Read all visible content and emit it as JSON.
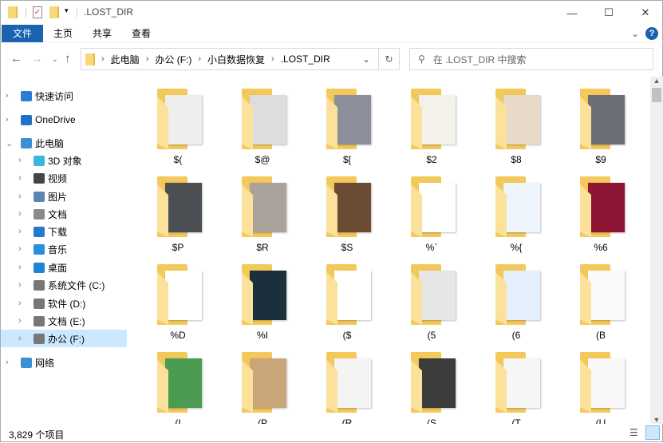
{
  "window": {
    "title": ".LOST_DIR",
    "minimize": "—",
    "maximize": "☐",
    "close": "✕"
  },
  "ribbon": {
    "tabs": [
      "文件",
      "主页",
      "共享",
      "查看"
    ],
    "help": "?",
    "expand": "⌄"
  },
  "address": {
    "crumbs": [
      "此电脑",
      "办公 (F:)",
      "小白数据恢复",
      ".LOST_DIR"
    ],
    "search_placeholder": "在 .LOST_DIR 中搜索"
  },
  "sidebar": {
    "items": [
      {
        "label": "快速访问",
        "icon": "star-icon",
        "color": "#2b7cd3"
      },
      {
        "label": "OneDrive",
        "icon": "cloud-icon",
        "color": "#1e73c8"
      },
      {
        "label": "此电脑",
        "icon": "computer-icon",
        "color": "#3b8fd6"
      },
      {
        "label": "3D 对象",
        "icon": "cube-icon",
        "color": "#3cb6e0"
      },
      {
        "label": "视频",
        "icon": "video-icon",
        "color": "#444"
      },
      {
        "label": "图片",
        "icon": "picture-icon",
        "color": "#5a86b6"
      },
      {
        "label": "文档",
        "icon": "document-icon",
        "color": "#8a8a8a"
      },
      {
        "label": "下载",
        "icon": "download-icon",
        "color": "#2479d2"
      },
      {
        "label": "音乐",
        "icon": "music-icon",
        "color": "#2b8fe0"
      },
      {
        "label": "桌面",
        "icon": "desktop-icon",
        "color": "#1f84d6"
      },
      {
        "label": "系统文件 (C:)",
        "icon": "drive-icon",
        "color": "#777"
      },
      {
        "label": "软件 (D:)",
        "icon": "drive-icon",
        "color": "#777"
      },
      {
        "label": "文档 (E:)",
        "icon": "drive-icon",
        "color": "#777"
      },
      {
        "label": "办公 (F:)",
        "icon": "drive-icon",
        "color": "#777"
      },
      {
        "label": "网络",
        "icon": "network-icon",
        "color": "#3b8fd6"
      }
    ],
    "selected": "办公 (F:)"
  },
  "folders": [
    {
      "name": "$(",
      "thumb": "#eeeeee"
    },
    {
      "name": "$@",
      "thumb": "#dddddd"
    },
    {
      "name": "$[",
      "thumb": "#8a8f99"
    },
    {
      "name": "$2",
      "thumb": "#f4f1ea"
    },
    {
      "name": "$8",
      "thumb": "#e9d9c8"
    },
    {
      "name": "$9",
      "thumb": "#6d6f78"
    },
    {
      "name": "$P",
      "thumb": "#4b4e52"
    },
    {
      "name": "$R",
      "thumb": "#a9a39c"
    },
    {
      "name": "$S",
      "thumb": "#6b4b33"
    },
    {
      "name": "%`",
      "thumb": "#ffffff"
    },
    {
      "name": "%{",
      "thumb": "#eef4fb"
    },
    {
      "name": "%6",
      "thumb": "#8f1535"
    },
    {
      "name": "%D",
      "thumb": "#ffffff"
    },
    {
      "name": "%I",
      "thumb": "#1b2f3d"
    },
    {
      "name": "($",
      "thumb": "#ffffff"
    },
    {
      "name": "(5",
      "thumb": "#e6e6e6"
    },
    {
      "name": "(6",
      "thumb": "#e4effc"
    },
    {
      "name": "(B",
      "thumb": "#fafafa"
    },
    {
      "name": "(I",
      "thumb": "#4b9c52"
    },
    {
      "name": "(P",
      "thumb": "#c9a67a"
    },
    {
      "name": "(R",
      "thumb": "#f4f4f4"
    },
    {
      "name": "(S",
      "thumb": "#3c3c3c"
    },
    {
      "name": "(T",
      "thumb": "#f6f6f6"
    },
    {
      "name": "(U",
      "thumb": "#f8f8f8"
    }
  ],
  "status": {
    "count": "3,829 个项目"
  }
}
